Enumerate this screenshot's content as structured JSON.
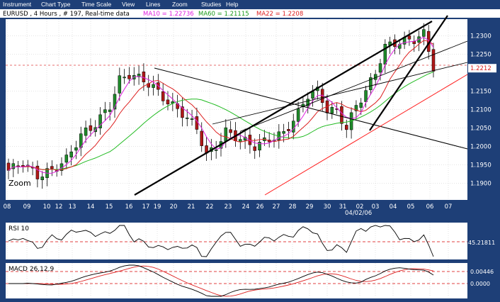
{
  "menu": [
    "Instrument",
    "Chart Type",
    "Time Scale",
    "View",
    "Lines",
    "Zoom",
    "Studies",
    "Help"
  ],
  "header": {
    "symbol": "EURUSD , 4 Hours , # 197, Real-time data",
    "ma10_label": "MA10 = 1.22736",
    "ma60_label": "MA60 = 1.21115",
    "ma22_label": "MA22 = 1.2208"
  },
  "zoom_label": "Zoom",
  "colors": {
    "background": "#1e3f77",
    "panel": "#ffffff",
    "up_candle": "#1f8a2a",
    "down_candle": "#b01818",
    "ma10": "#e020e0",
    "ma60": "#22bb22",
    "ma22": "#dd2020",
    "trendline": "#000000",
    "channel": "#ff2020"
  },
  "price_panel": {
    "ymin": 1.1855,
    "ymax": 1.2345,
    "yticks": [
      "1.2300",
      "1.2250",
      "1.2212",
      "1.2150",
      "1.2100",
      "1.2050",
      "1.2000",
      "1.1950",
      "1.1900"
    ],
    "highlight_price": "1.2212",
    "x_ticks": [
      "08",
      "09",
      "10",
      "12",
      "13",
      "14",
      "15",
      "16",
      "17",
      "19",
      "20",
      "21",
      "22",
      "23",
      "24",
      "26",
      "27",
      "28",
      "29",
      "30",
      "31",
      "02",
      "03",
      "04",
      "05",
      "06",
      "07"
    ],
    "month_label": "04/02/06"
  },
  "rsi_panel": {
    "title": "RSI 10",
    "value_label": "45.21811"
  },
  "macd_panel": {
    "title": "MACD 26,12,9",
    "value_labels": [
      "0.00446",
      "0.0000"
    ]
  },
  "chart_data": {
    "type": "candlestick",
    "title": "EURUSD , 4 Hours , # 197, Real-time data",
    "ylim": [
      1.1855,
      1.2345
    ],
    "anchors": [
      [
        0,
        1.1935
      ],
      [
        3,
        1.1955
      ],
      [
        6,
        1.192
      ],
      [
        9,
        1.1935
      ],
      [
        12,
        1.1965
      ],
      [
        15,
        1.203
      ],
      [
        18,
        1.206
      ],
      [
        21,
        1.211
      ],
      [
        23,
        1.218
      ],
      [
        25,
        1.2195
      ],
      [
        28,
        1.218
      ],
      [
        30,
        1.216
      ],
      [
        33,
        1.212
      ],
      [
        36,
        1.209
      ],
      [
        39,
        1.205
      ],
      [
        41,
        1.1975
      ],
      [
        43,
        1.2
      ],
      [
        45,
        1.204
      ],
      [
        48,
        1.202
      ],
      [
        51,
        1.2
      ],
      [
        54,
        1.202
      ],
      [
        57,
        1.2035
      ],
      [
        60,
        1.209
      ],
      [
        62,
        1.214
      ],
      [
        64,
        1.215
      ],
      [
        66,
        1.21
      ],
      [
        68,
        1.2095
      ],
      [
        70,
        1.205
      ],
      [
        72,
        1.211
      ],
      [
        74,
        1.215
      ],
      [
        76,
        1.22
      ],
      [
        78,
        1.227
      ],
      [
        80,
        1.228
      ],
      [
        82,
        1.2285
      ],
      [
        84,
        1.229
      ],
      [
        86,
        1.2305
      ],
      [
        88,
        1.2215
      ]
    ]
  }
}
